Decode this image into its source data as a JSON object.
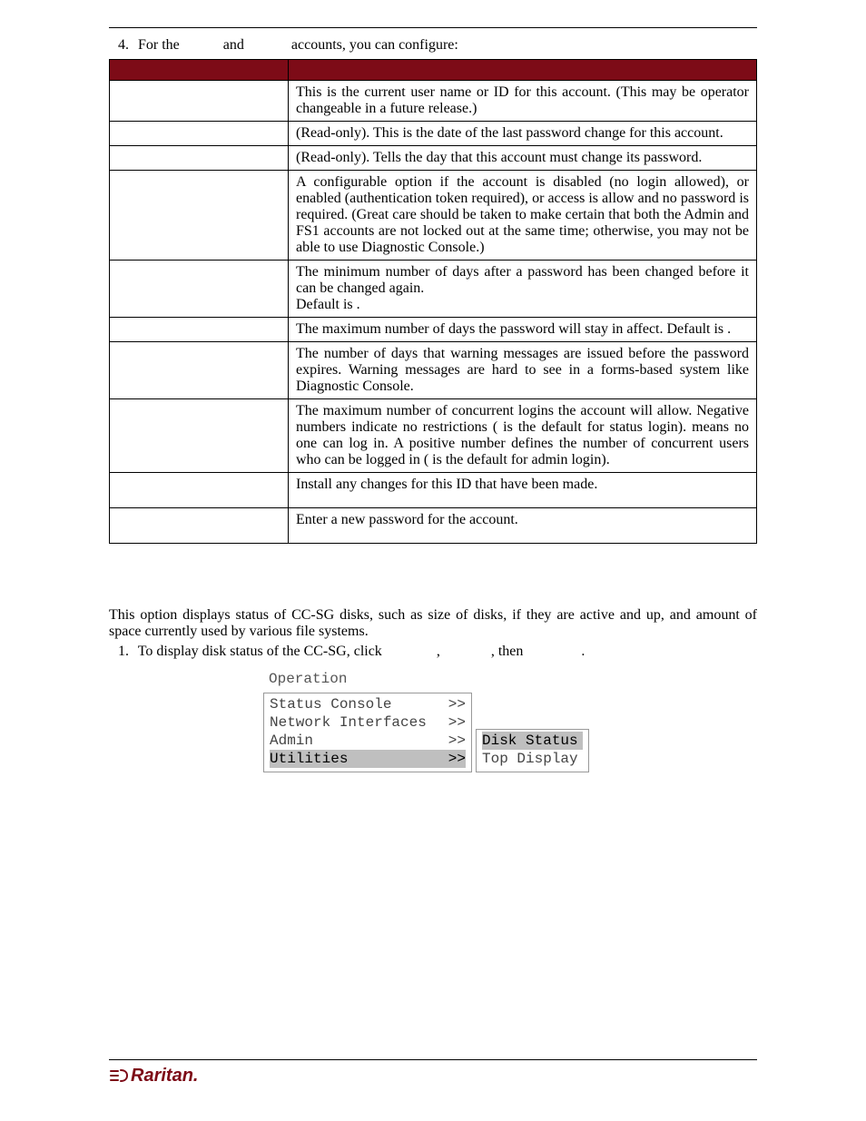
{
  "intro": {
    "num": "4.",
    "prefix": "For the",
    "mid": "and",
    "suffix": "accounts, you can configure:"
  },
  "table_header": {
    "c1": "",
    "c2": ""
  },
  "rows": [
    {
      "c1": "",
      "c2": "This is the current user name or ID for this account.  (This may be operator changeable in a future release.)"
    },
    {
      "c1": "",
      "c2": "(Read-only). This is the date of the last password change for this account."
    },
    {
      "c1": "",
      "c2": "(Read-only). Tells the day that this account must change its password."
    },
    {
      "c1": "",
      "c2": "A configurable option if the account is disabled (no login allowed), or enabled (authentication token required), or access is allow and no password is required.  (Great care should be taken to make certain that both the Admin and FS1 accounts are not locked out at the same time; otherwise, you may not be able to use Diagnostic Console.)"
    },
    {
      "c1": "",
      "c2": "The minimum number of days after a password has been changed before it can be changed again.",
      "extra": " Default is   ."
    },
    {
      "c1": "",
      "c2": "The maximum number of days the password will stay in affect. Default is             ."
    },
    {
      "c1": "",
      "c2": "The number of days that warning messages are issued before the password expires. Warning messages are hard to see in a forms-based system like Diagnostic Console."
    },
    {
      "c1": "",
      "c2": "The maximum number of concurrent logins the account will allow. Negative numbers indicate no restrictions (    is the default for status login).    means no one can log in. A positive number defines the number of concurrent users who can be logged in (   is the default for admin login)."
    },
    {
      "c1": "",
      "c2": "Install any changes for this ID that have been made."
    },
    {
      "c1": "",
      "c2": "Enter a new password for the account."
    }
  ],
  "section_body": "This option displays status of CC-SG disks, such as size of disks, if they are active and up, and amount of space currently used by various file systems.",
  "step": {
    "num": "1.",
    "a": "To display disk status of the CC-SG, click",
    "b": ",",
    "c": ", then",
    "d": "."
  },
  "menu": {
    "title": "Operation",
    "items": [
      {
        "label": "Status Console",
        "arrow": ">>",
        "sel": false
      },
      {
        "label": "Network Interfaces",
        "arrow": ">>",
        "sel": false
      },
      {
        "label": "Admin",
        "arrow": ">>",
        "sel": false
      },
      {
        "label": "Utilities",
        "arrow": ">>",
        "sel": true
      }
    ],
    "sub": [
      {
        "label": "Disk Status",
        "sel": true
      },
      {
        "label": "Top Display",
        "sel": false
      }
    ]
  },
  "brand": "Raritan."
}
